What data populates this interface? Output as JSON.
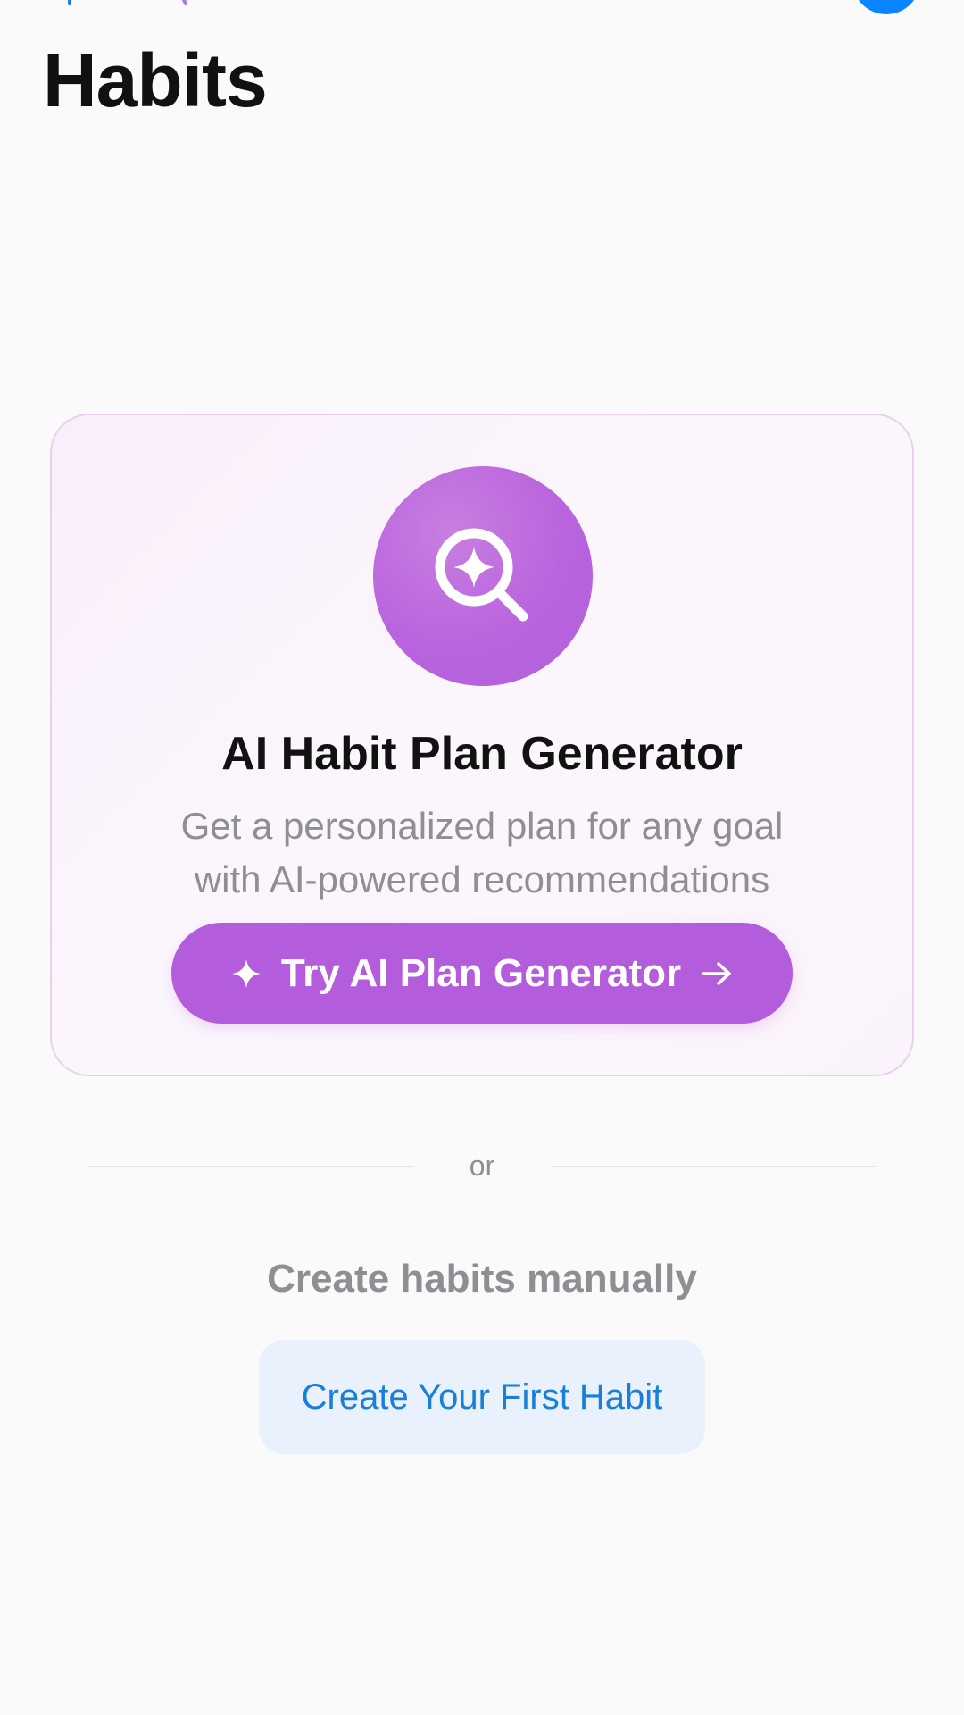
{
  "header": {
    "title": "Habits"
  },
  "ai_card": {
    "icon": "sparkle-magnifier-icon",
    "title": "AI Habit Plan Generator",
    "subtitle_line1": "Get a personalized plan for any goal",
    "subtitle_line2": "with AI-powered recommendations",
    "button_label": "Try AI Plan Generator"
  },
  "divider": {
    "label": "or"
  },
  "manual": {
    "heading": "Create habits manually",
    "button_label": "Create Your First Habit"
  },
  "colors": {
    "accent_purple": "#b45ddc",
    "link_blue": "#1a7fd6",
    "avatar_blue": "#0a84ff"
  }
}
